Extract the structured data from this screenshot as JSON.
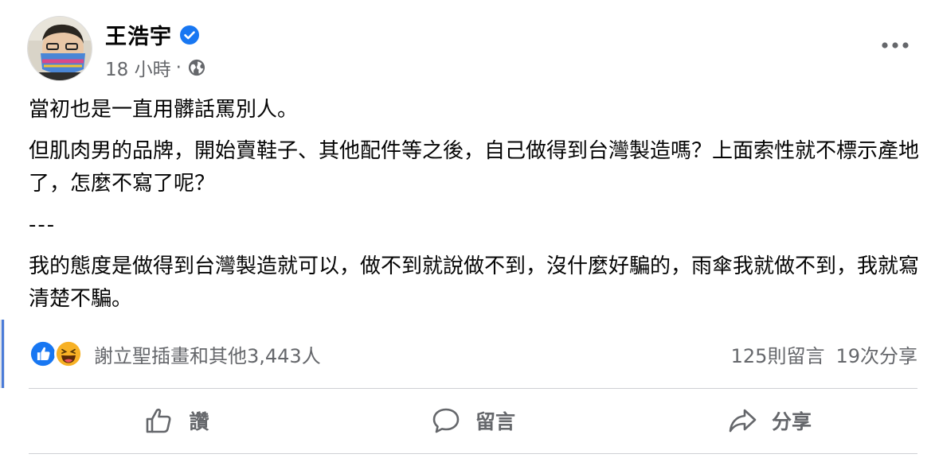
{
  "post": {
    "author": "王浩宇",
    "time": "18 小時",
    "meta_separator": "·",
    "verified_icon": "verified-badge-icon",
    "audience_icon": "globe-icon",
    "paragraphs": [
      "當初也是一直用髒話罵別人。",
      "但肌肉男的品牌，開始賣鞋子、其他配件等之後，自己做得到台灣製造嗎？上面索性就不標示產地了，怎麼不寫了呢？",
      "---",
      "我的態度是做得到台灣製造就可以，做不到就說做不到，沒什麼好騙的，雨傘我就做不到，我就寫清楚不騙。"
    ]
  },
  "reactions": {
    "icons": [
      "like-icon",
      "haha-icon"
    ],
    "summary": "謝立聖插畫和其他3,443人",
    "comments": "125則留言",
    "shares": "19次分享"
  },
  "actions": {
    "like": "讚",
    "comment": "留言",
    "share": "分享"
  },
  "colors": {
    "accent_blue": "#1877f2",
    "secondary_text": "#65676b",
    "divider": "#ced0d4"
  }
}
